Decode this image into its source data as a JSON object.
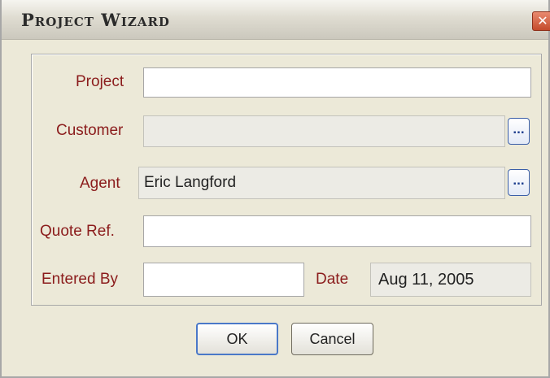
{
  "window": {
    "title": "Project Wizard",
    "close_glyph": "✕"
  },
  "form": {
    "project_label": "Project",
    "project_value": "",
    "customer_label": "Customer",
    "customer_value": "",
    "customer_browse": "...",
    "agent_label": "Agent",
    "agent_value": "Eric Langford",
    "agent_browse": "...",
    "quote_label": "Quote Ref.",
    "quote_value": "",
    "entered_by_label": "Entered By",
    "entered_by_value": "",
    "date_label": "Date",
    "date_value": "Aug 11, 2005"
  },
  "buttons": {
    "ok": "OK",
    "cancel": "Cancel"
  },
  "colors": {
    "label": "#8b1c1c",
    "dialog_bg": "#ece9d8",
    "default_button_border": "#4a78c8"
  }
}
